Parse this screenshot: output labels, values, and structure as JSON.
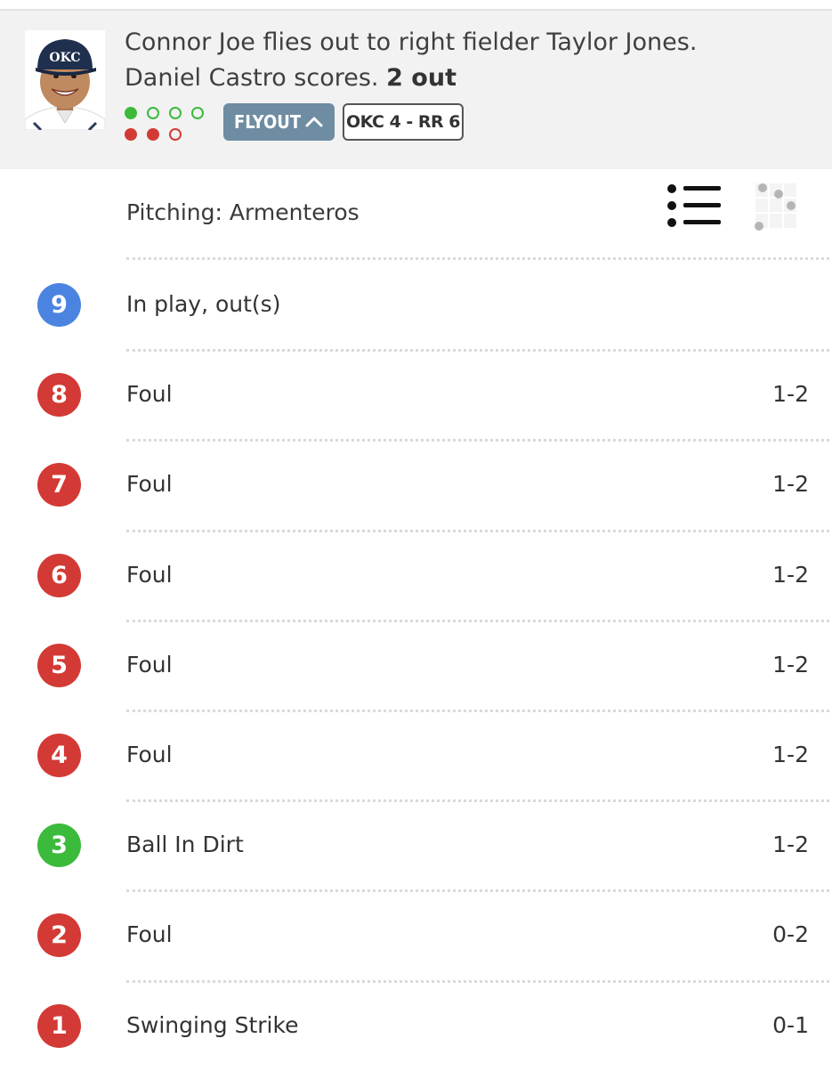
{
  "play": {
    "description": "Connor Joe flies out to right fielder Taylor Jones.",
    "description_line2": "Daniel Castro scores.",
    "outs_text": "2 out",
    "balls": 1,
    "balls_max": 4,
    "strikes": 2,
    "strikes_max": 3,
    "result_badge": "FLYOUT",
    "score_badge": "OKC 4 - RR 6"
  },
  "pitching_label": "Pitching: Armenteros",
  "colors": {
    "ball": "#3cba3c",
    "strike": "#d33a35",
    "in_play": "#4a84e0"
  },
  "pitches": [
    {
      "num": "9",
      "label": "In play, out(s)",
      "count": "",
      "type": "in_play"
    },
    {
      "num": "8",
      "label": "Foul",
      "count": "1-2",
      "type": "strike"
    },
    {
      "num": "7",
      "label": "Foul",
      "count": "1-2",
      "type": "strike"
    },
    {
      "num": "6",
      "label": "Foul",
      "count": "1-2",
      "type": "strike"
    },
    {
      "num": "5",
      "label": "Foul",
      "count": "1-2",
      "type": "strike"
    },
    {
      "num": "4",
      "label": "Foul",
      "count": "1-2",
      "type": "strike"
    },
    {
      "num": "3",
      "label": "Ball In Dirt",
      "count": "1-2",
      "type": "ball"
    },
    {
      "num": "2",
      "label": "Foul",
      "count": "0-2",
      "type": "strike"
    },
    {
      "num": "1",
      "label": "Swinging Strike",
      "count": "0-1",
      "type": "strike"
    }
  ]
}
